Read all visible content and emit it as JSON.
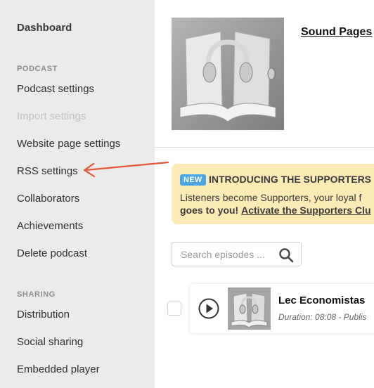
{
  "sidebar": {
    "dashboard": "Dashboard",
    "sections": [
      {
        "label": "PODCAST",
        "items": [
          {
            "label": "Podcast settings",
            "disabled": false
          },
          {
            "label": "Import settings",
            "disabled": true
          },
          {
            "label": "Website page settings",
            "disabled": false
          },
          {
            "label": "RSS settings",
            "disabled": false
          },
          {
            "label": "Collaborators",
            "disabled": false
          },
          {
            "label": "Achievements",
            "disabled": false
          },
          {
            "label": "Delete podcast",
            "disabled": false
          }
        ]
      },
      {
        "label": "SHARING",
        "items": [
          {
            "label": "Distribution",
            "disabled": false
          },
          {
            "label": "Social sharing",
            "disabled": false
          },
          {
            "label": "Embedded player",
            "disabled": false
          }
        ]
      }
    ]
  },
  "podcast": {
    "title": "Sound Pages"
  },
  "banner": {
    "badge": "NEW",
    "title": "INTRODUCING THE SUPPORTERS C",
    "line1": "Listeners become Supporters, your loyal f",
    "line2_bold": "goes to you!",
    "line2_link": "Activate the Supporters Clu"
  },
  "search": {
    "placeholder": "Search episodes ..."
  },
  "episodes": [
    {
      "title": "Lec Economistas",
      "meta": "Duration: 08:08 - Publis"
    }
  ],
  "colors": {
    "sidebar_bg": "#ebebeb",
    "banner_bg": "#fdebb5",
    "badge_bg": "#4aa6e8",
    "arrow": "#e8553a"
  },
  "icons": [
    "search-icon",
    "play-icon",
    "annotation-arrow"
  ]
}
